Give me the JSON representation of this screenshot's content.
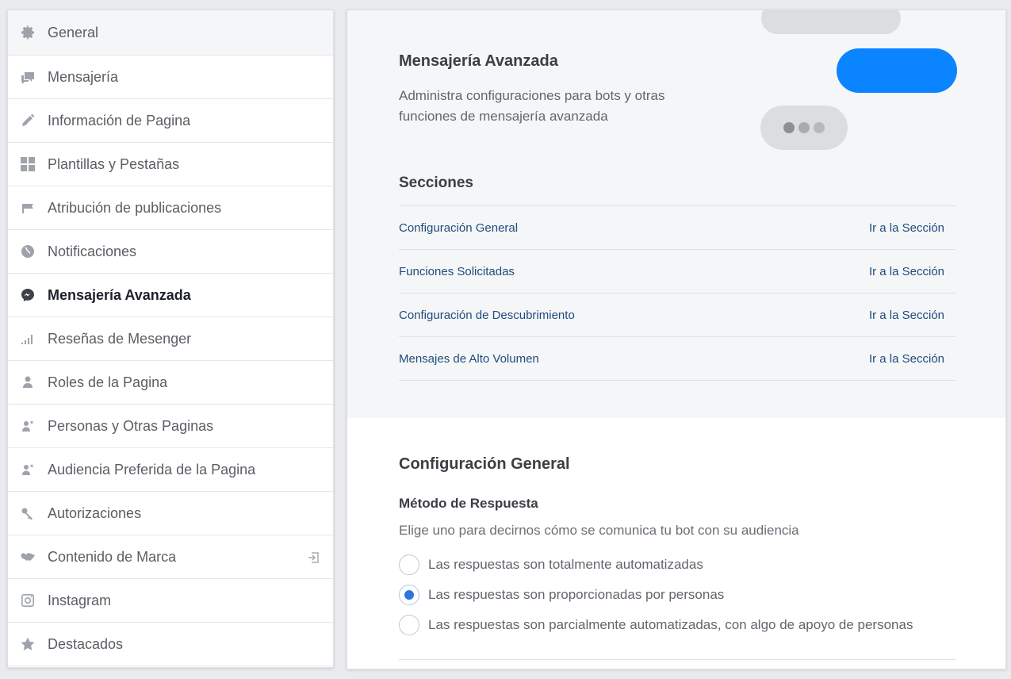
{
  "sidebar": {
    "items": [
      {
        "label": "General",
        "icon": "gear-icon"
      },
      {
        "label": "Mensajería",
        "icon": "chat-icon"
      },
      {
        "label": "Información de Pagina",
        "icon": "pencil-icon"
      },
      {
        "label": "Plantillas y Pestañas",
        "icon": "grid-icon"
      },
      {
        "label": "Atribución de publicaciones",
        "icon": "flag-icon"
      },
      {
        "label": "Notificaciones",
        "icon": "globe-icon"
      },
      {
        "label": "Mensajería Avanzada",
        "icon": "messenger-icon"
      },
      {
        "label": "Reseñas de Mesenger",
        "icon": "signal-bars-icon"
      },
      {
        "label": "Roles de la Pagina",
        "icon": "person-icon"
      },
      {
        "label": "Personas y Otras Paginas",
        "icon": "person-star-icon"
      },
      {
        "label": "Audiencia Preferida de la Pagina",
        "icon": "person-star-icon"
      },
      {
        "label": "Autorizaciones",
        "icon": "key-icon"
      },
      {
        "label": "Contenido de Marca",
        "icon": "handshake-icon"
      },
      {
        "label": "Instagram",
        "icon": "instagram-icon"
      },
      {
        "label": "Destacados",
        "icon": "star-icon"
      }
    ]
  },
  "hero": {
    "title": "Mensajería Avanzada",
    "description": "Administra configuraciones para bots y otras funciones de mensajería avanzada"
  },
  "sections": {
    "title": "Secciones",
    "go_label": "Ir a la Sección",
    "rows": [
      "Configuración General",
      "Funciones Solicitadas",
      "Configuración de Descubrimiento",
      "Mensajes de Alto Volumen"
    ]
  },
  "config": {
    "title": "Configuración General",
    "method_title": "Método de Respuesta",
    "method_desc": "Elige uno para decirnos cómo se comunica tu bot con su audiencia",
    "options": [
      "Las respuestas son totalmente automatizadas",
      "Las respuestas son proporcionadas por personas",
      "Las respuestas son parcialmente automatizadas, con algo de apoyo de personas"
    ],
    "selected_index": 1
  },
  "colors": {
    "accent_blue": "#0a84ff",
    "link": "#1f4b7e",
    "radio_checked": "#2f74e0"
  }
}
